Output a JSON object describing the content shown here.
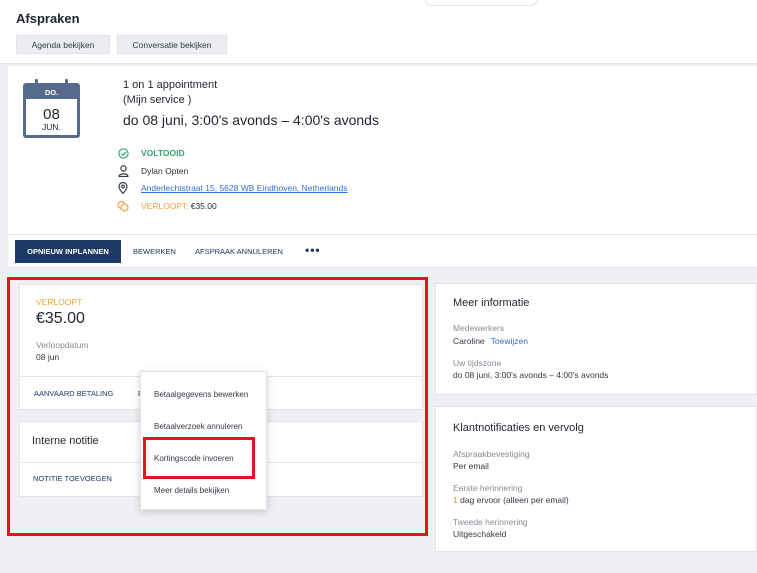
{
  "page": {
    "title": "Afspraken"
  },
  "tabs": [
    {
      "label": "Agenda bekijken"
    },
    {
      "label": "Conversatie bekijken"
    }
  ],
  "appointment": {
    "calendar": {
      "weekday": "DO.",
      "day": "08",
      "month": "JUN."
    },
    "type": "1 on 1 appointment",
    "service": "(Mijn service )",
    "datetime": "do 08 juni, 3:00's avonds – 4:00's avonds",
    "status": "VOLTOOID",
    "status_color": "#2fa46e",
    "staff": "Dylan Opten",
    "address": "Anderlechtstraat 15, 5628 WB Eindhoven, Netherlands",
    "payment_label": "VERLOOPT:",
    "payment_amount": "€35.00",
    "icons": {
      "status": "check-circle-icon",
      "staff": "person-icon",
      "address": "location-pin-icon",
      "payment": "coins-icon"
    }
  },
  "actions": {
    "reschedule": "OPNIEUW INPLANNEN",
    "edit": "BEWERKEN",
    "cancel": "AFSPRAAK ANNULEREN",
    "more": "•••"
  },
  "payment_card": {
    "status": "VERLOOPT",
    "amount": "€35.00",
    "due_label": "Verloopdatum",
    "due_value": "08 jun",
    "accept": "AANVAARD BETALING",
    "more_partial": "F"
  },
  "dropdown": {
    "items": [
      {
        "label": "Betaalgegevens bewerken"
      },
      {
        "label": "Betaalverzoek annuleren"
      },
      {
        "label": "Kortingscode invoeren"
      },
      {
        "label": "Meer details bekijken"
      }
    ]
  },
  "notes_card": {
    "title": "Interne notitie",
    "add": "NOTITIE TOEVOEGEN"
  },
  "more_info": {
    "title": "Meer informatie",
    "staff_label": "Medewerkers",
    "staff_value": "Caroline",
    "assign": "Toewijzen",
    "timezone_label": "Uw tijdszone",
    "timezone_value": "do 08 juni, 3:00's avonds – 4:00's avonds"
  },
  "notifications": {
    "title": "Klantnotificaties en vervolg",
    "confirm_label": "Afspraakbevestiging",
    "confirm_value": "Per email",
    "first_label": "Eerste herinnering",
    "first_value_num": "1",
    "first_value_rest": " dag ervoor (alleen per email)",
    "second_label": "Tweede herinnering",
    "second_value": "Uitgeschakeld"
  },
  "colors": {
    "primary": "#1c3a63",
    "warning": "#f0a23a",
    "link": "#2f6fd6",
    "highlight": "#e4141c"
  }
}
